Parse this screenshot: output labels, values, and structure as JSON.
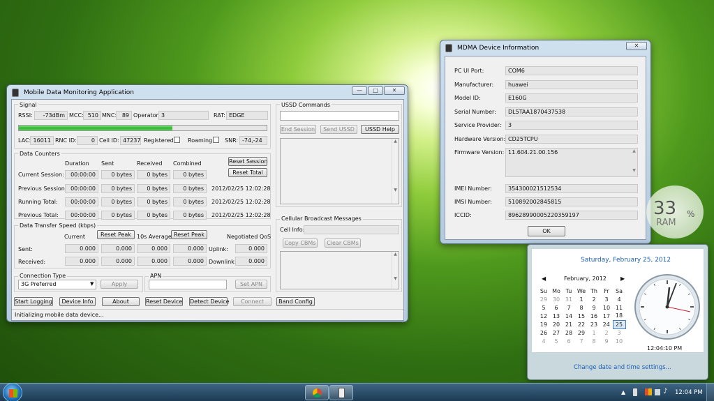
{
  "mdm": {
    "title": "Mobile Data Monitoring Application",
    "signal": {
      "group": "Signal",
      "rssi_label": "RSSI:",
      "rssi": "-73dBm",
      "mcc_label": "MCC:",
      "mcc": "510",
      "mnc_label": "MNC:",
      "mnc": "89",
      "operator_label": "Operator:",
      "operator": "3",
      "rat_label": "RAT:",
      "rat": "EDGE",
      "strength": 0.62,
      "lac_label": "LAC:",
      "lac": "16011",
      "rnc_label": "RNC ID:",
      "rnc": "0",
      "cell_label": "Cell ID:",
      "cell": "47237",
      "registered_label": "Registered:",
      "roaming_label": "Roaming:",
      "snr_label": "SNR:",
      "snr": "-74,-24"
    },
    "counters": {
      "group": "Data Counters",
      "headers": [
        "Duration",
        "Sent",
        "Received",
        "Combined"
      ],
      "reset_session": "Reset Session",
      "reset_total": "Reset Total",
      "rows": [
        {
          "label": "Current Session:",
          "duration": "00:00:00",
          "sent": "0 bytes",
          "received": "0 bytes",
          "combined": "0 bytes",
          "date": ""
        },
        {
          "label": "Previous Session:",
          "duration": "00:00:00",
          "sent": "0 bytes",
          "received": "0 bytes",
          "combined": "0 bytes",
          "date": "2012/02/25 12:02:28"
        },
        {
          "label": "Running Total:",
          "duration": "00:00:00",
          "sent": "0 bytes",
          "received": "0 bytes",
          "combined": "0 bytes",
          "date": "2012/02/25 12:02:28"
        },
        {
          "label": "Previous Total:",
          "duration": "00:00:00",
          "sent": "0 bytes",
          "received": "0 bytes",
          "combined": "0 bytes",
          "date": "2012/02/25 12:02:28"
        }
      ]
    },
    "speed": {
      "group": "Data Transfer Speed (kbps)",
      "current": "Current",
      "reset_peak": "Reset Peak",
      "avg": "10s Average",
      "qos": "Negotiated QoS",
      "sent_label": "Sent:",
      "received_label": "Received:",
      "uplink_label": "Uplink:",
      "downlink_label": "Downlink:",
      "sent": [
        "0.000",
        "0.000",
        "0.000",
        "0.000",
        "0.000"
      ],
      "received": [
        "0.000",
        "0.000",
        "0.000",
        "0.000",
        "0.000"
      ]
    },
    "conn": {
      "group": "Connection Type",
      "value": "3G Preferred",
      "apply": "Apply",
      "apn_group": "APN",
      "apn_value": "",
      "set_apn": "Set APN"
    },
    "ussd": {
      "group": "USSD Commands",
      "end": "End Session",
      "send": "Send USSD",
      "help": "USSD Help"
    },
    "cbm": {
      "group": "Cellular Broadcast Messages",
      "cell_info": "Cell Info:",
      "copy": "Copy CBMs",
      "clear": "Clear CBMs"
    },
    "buttons": [
      "Start Logging",
      "Device Info",
      "About",
      "Reset Device",
      "Detect Device",
      "Connect",
      "Band Config"
    ],
    "status": "Initializing mobile data device..."
  },
  "info": {
    "title": "MDMA Device Information",
    "rows": [
      {
        "label": "PC UI Port:",
        "value": "COM6"
      },
      {
        "label": "Manufacturer:",
        "value": "huawei"
      },
      {
        "label": "Model ID:",
        "value": "E160G"
      },
      {
        "label": "Serial Number:",
        "value": "DL5TAA1870437538"
      },
      {
        "label": "Service Provider:",
        "value": "3"
      },
      {
        "label": "Hardware Version:",
        "value": "CD25TCPU"
      }
    ],
    "firmware_label": "Firmware Version:",
    "firmware": "11.604.21.00.156",
    "rows2": [
      {
        "label": "IMEI Number:",
        "value": "354300021512534"
      },
      {
        "label": "IMSI Number:",
        "value": "510892002845815"
      },
      {
        "label": "ICCID:",
        "value": "89628990005220359197"
      }
    ],
    "ok": "OK"
  },
  "gadget": {
    "value": "33",
    "unit": "%",
    "label": "RAM",
    "level": 0.33
  },
  "calendar": {
    "date_title": "Saturday, February 25, 2012",
    "month": "February, 2012",
    "weekdays": [
      "Su",
      "Mo",
      "Tu",
      "We",
      "Th",
      "Fr",
      "Sa"
    ],
    "weeks": [
      [
        "29",
        "30",
        "31",
        "1",
        "2",
        "3",
        "4"
      ],
      [
        "5",
        "6",
        "7",
        "8",
        "9",
        "10",
        "11"
      ],
      [
        "12",
        "13",
        "14",
        "15",
        "16",
        "17",
        "18"
      ],
      [
        "19",
        "20",
        "21",
        "22",
        "23",
        "24",
        "25"
      ],
      [
        "26",
        "27",
        "28",
        "29",
        "1",
        "2",
        "3"
      ],
      [
        "4",
        "5",
        "6",
        "7",
        "8",
        "9",
        "10"
      ]
    ],
    "time": "12:04:10 PM",
    "settings_link": "Change date and time settings..."
  },
  "taskbar": {
    "clock": "12:04 PM"
  },
  "colors": {
    "signal_bar": "#3ec23e",
    "link": "#1d5fb5"
  }
}
